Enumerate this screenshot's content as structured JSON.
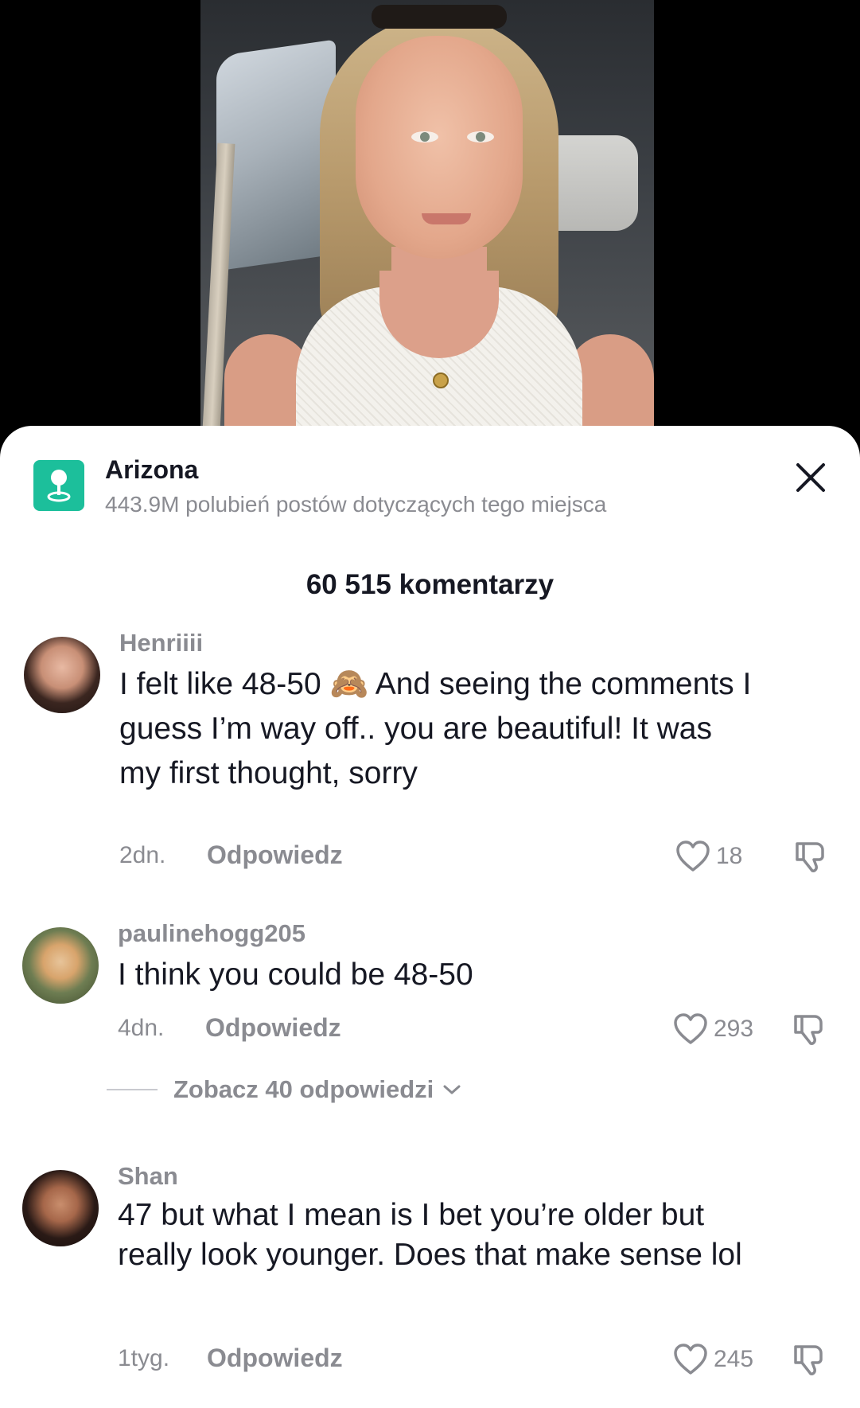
{
  "location": {
    "title": "Arizona",
    "subtitle": "443.9M polubień postów dotyczących tego miejsca",
    "icon": "location-pin-icon",
    "icon_color": "#1cbf9b"
  },
  "comments_header": {
    "count_label": "60 515 komentarzy"
  },
  "comments": [
    {
      "username": "Henriiii",
      "text": "I felt like 48-50 🙈 And seeing the comments I guess I’m way off.. you are beautiful! It was my first thought, sorry",
      "time": "2dn.",
      "reply_label": "Odpowiedz",
      "likes": "18"
    },
    {
      "username": "paulinehogg205",
      "text": "I think you could be 48-50",
      "time": "4dn.",
      "reply_label": "Odpowiedz",
      "likes": "293",
      "view_replies_label": "Zobacz 40 odpowiedzi"
    },
    {
      "username": "Shan",
      "text": "47 but what I mean is I bet you’re older but really look younger. Does that make sense lol",
      "time": "1tyg.",
      "reply_label": "Odpowiedz",
      "likes": "245"
    }
  ],
  "colors": {
    "text_primary": "#161823",
    "text_secondary": "#8a8b91",
    "sheet_background": "#ffffff",
    "video_background": "#000000"
  }
}
